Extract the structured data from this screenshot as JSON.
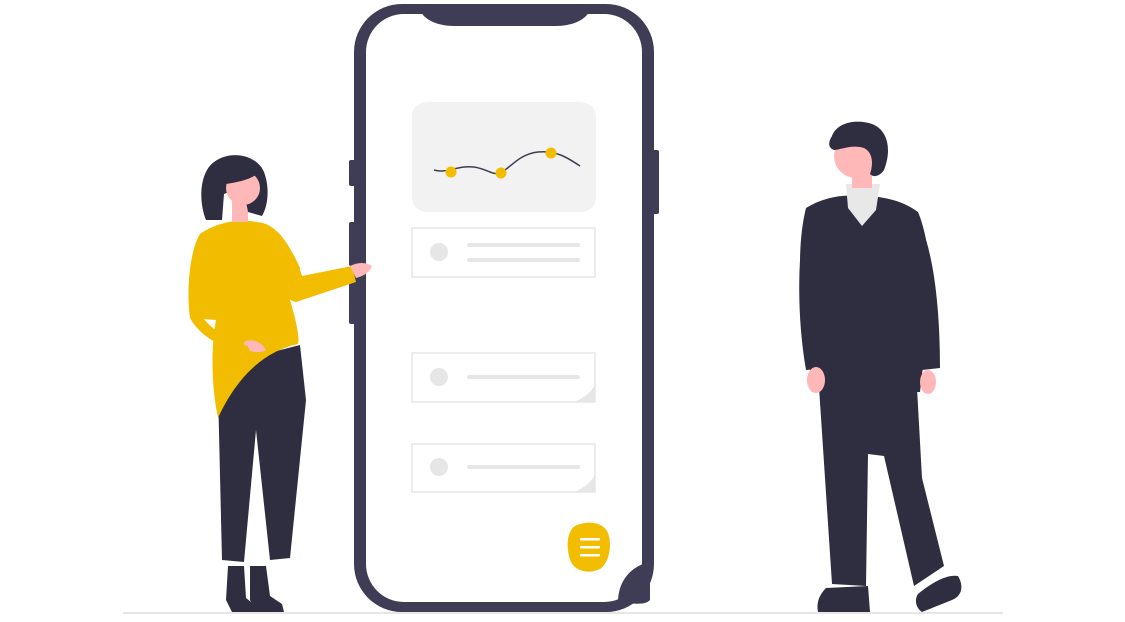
{
  "illustration": {
    "description_free": true,
    "colors": {
      "dark": "#3f3d56",
      "suit": "#2f2e41",
      "accent": "#f2bd00",
      "skin": "#ffb8b8",
      "screen": "#ffffff",
      "panel": "#f2f2f2",
      "line": "#e6e6e6",
      "ground": "#e6e6e6",
      "collar": "#e8e8e8"
    },
    "phone": {
      "chart_points": 3,
      "cards": 3,
      "menu_icon": "menu-icon"
    }
  }
}
